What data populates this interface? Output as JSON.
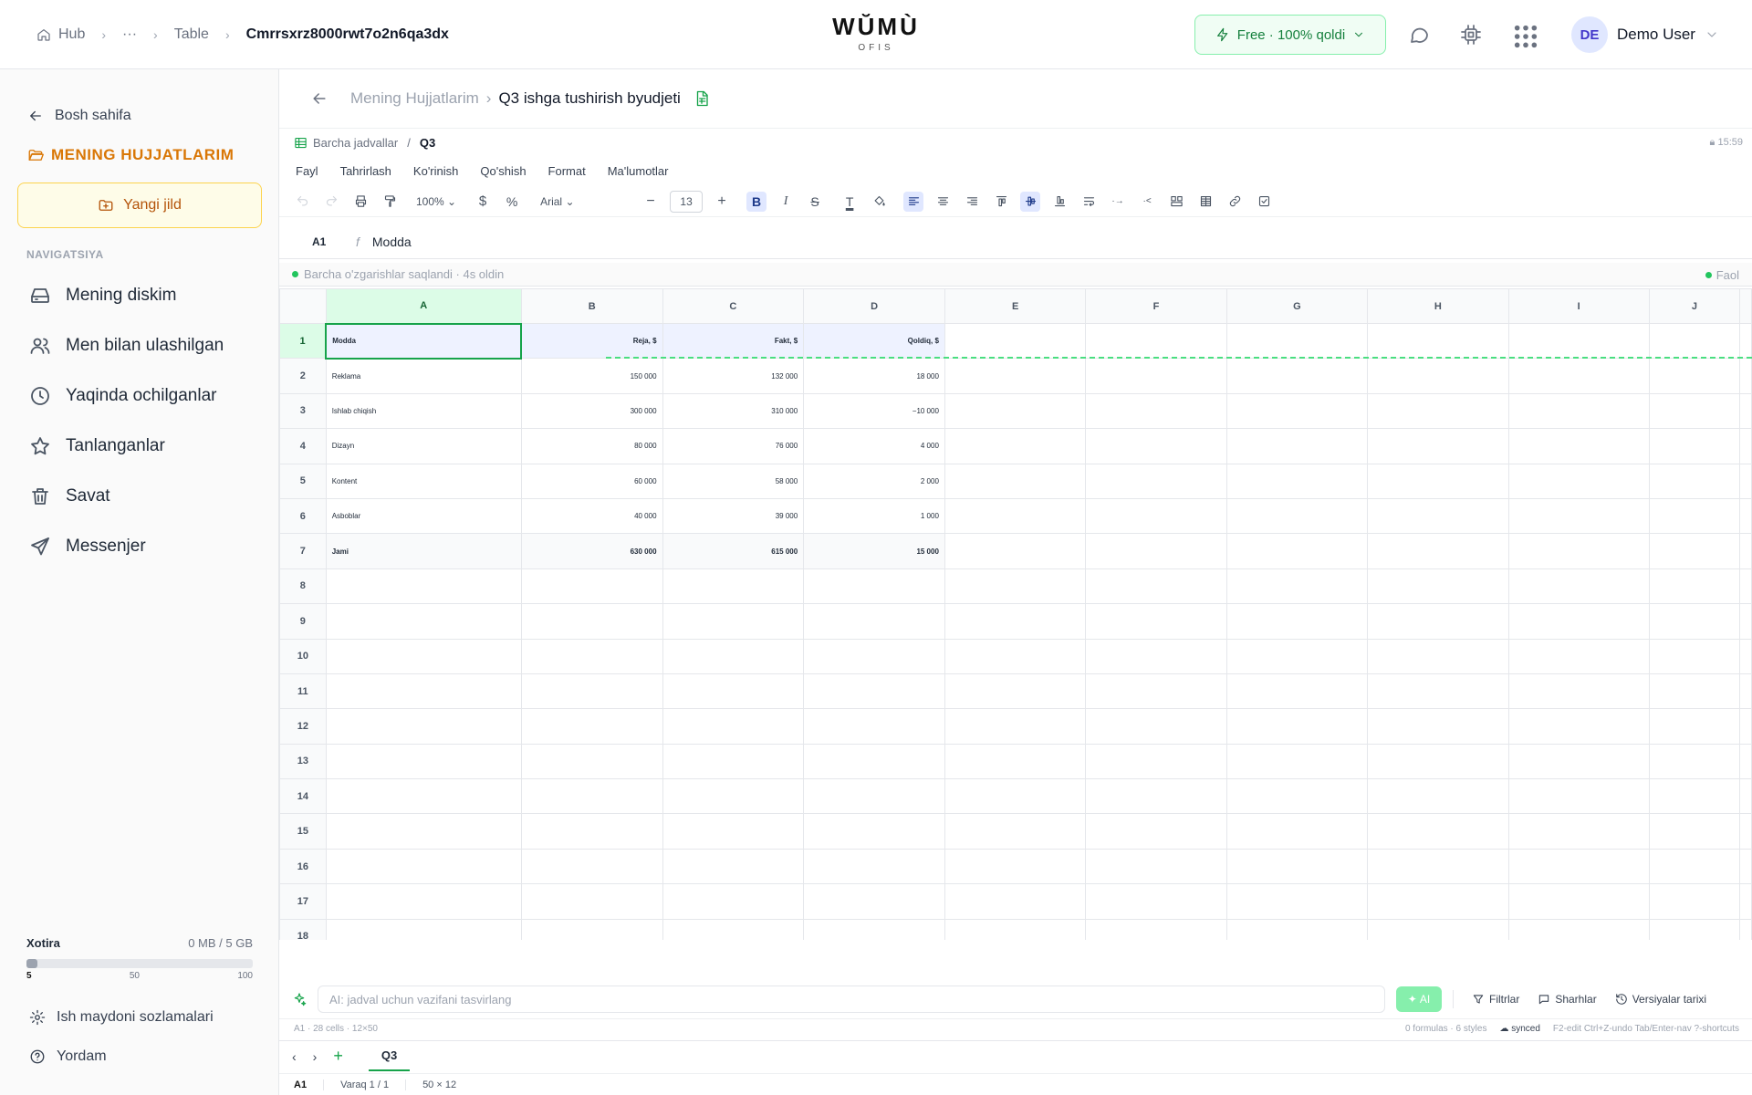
{
  "topbar": {
    "breadcrumb": [
      "Hub",
      "···",
      "Table",
      "Cmrrsxrz8000rwt7o2n6qa3dx"
    ],
    "logo": "WŬMÙ",
    "logo_sub": "OFIS",
    "plan": "Free · 100% qoldi",
    "user_initials": "DE",
    "user_name": "Demo User"
  },
  "sidebar": {
    "back": "Bosh sahifa",
    "docs_title": "MENING HUJJATLARIM",
    "new_folder": "Yangi jild",
    "nav_heading": "NAVIGATSIYA",
    "items": [
      {
        "label": "Mening diskim",
        "icon": "drive-icon"
      },
      {
        "label": "Men bilan ulashilgan",
        "icon": "users-icon"
      },
      {
        "label": "Yaqinda ochilganlar",
        "icon": "clock-icon"
      },
      {
        "label": "Tanlanganlar",
        "icon": "star-icon"
      },
      {
        "label": "Savat",
        "icon": "trash-icon"
      },
      {
        "label": "Messenjer",
        "icon": "send-icon"
      }
    ],
    "storage_label": "Xotira",
    "storage_value": "0 MB / 5 GB",
    "storage_ticks": [
      "5",
      "50",
      "100"
    ],
    "storage_fill": 0.05,
    "settings": "Ish maydoni sozlamalari",
    "help": "Yordam"
  },
  "doc": {
    "crumb_root": "Mening Hujjatlarim",
    "crumb_sep": "›",
    "title": "Q3 ishga tushirish byudjeti",
    "sheets_link": "Barcha jadvallar",
    "sheet_sep": "/",
    "sheet": "Q3",
    "time": "15:59"
  },
  "menu": [
    "Fayl",
    "Tahrirlash",
    "Ko'rinish",
    "Qo'shish",
    "Format",
    "Ma'lumotlar"
  ],
  "toolbar": {
    "zoom": "100%",
    "font": "Arial",
    "font_size": "13"
  },
  "formula": {
    "ref": "A1",
    "fx": "f",
    "value": "Modda"
  },
  "save_status": "Barcha o'zgarishlar saqlandi · 4s oldin",
  "active_status": "Faol",
  "grid": {
    "columns": [
      "A",
      "B",
      "C",
      "D",
      "E",
      "F",
      "G",
      "H",
      "I",
      "J"
    ],
    "rows": [
      [
        "Modda",
        "Reja, $",
        "Fakt, $",
        "Qoldiq, $"
      ],
      [
        "Reklama",
        "150 000",
        "132 000",
        "18 000"
      ],
      [
        "Ishlab chiqish",
        "300 000",
        "310 000",
        "−10 000"
      ],
      [
        "Dizayn",
        "80 000",
        "76 000",
        "4 000"
      ],
      [
        "Kontent",
        "60 000",
        "58 000",
        "2 000"
      ],
      [
        "Asboblar",
        "40 000",
        "39 000",
        "1 000"
      ],
      [
        "Jami",
        "630 000",
        "615 000",
        "15 000"
      ]
    ],
    "row_count": 19
  },
  "ai": {
    "placeholder": "AI: jadval uchun vazifani tasvirlang",
    "button": "AI",
    "filters": "Filtrlar",
    "comments": "Sharhlar",
    "history": "Versiyalar tarixi"
  },
  "status": {
    "left": "A1 · 28 cells · 12×50",
    "formulas": "0 formulas · 6 styles",
    "synced": "synced",
    "shortcuts": "F2-edit Ctrl+Z-undo Tab/Enter-nav ?-shortcuts"
  },
  "tabs": {
    "sheet": "Q3"
  },
  "bottom": {
    "ref": "A1",
    "page": "Varaq 1 / 1",
    "size": "50 × 12"
  },
  "colors": {
    "accent": "#16a34a",
    "brand_orange": "#d97706"
  }
}
